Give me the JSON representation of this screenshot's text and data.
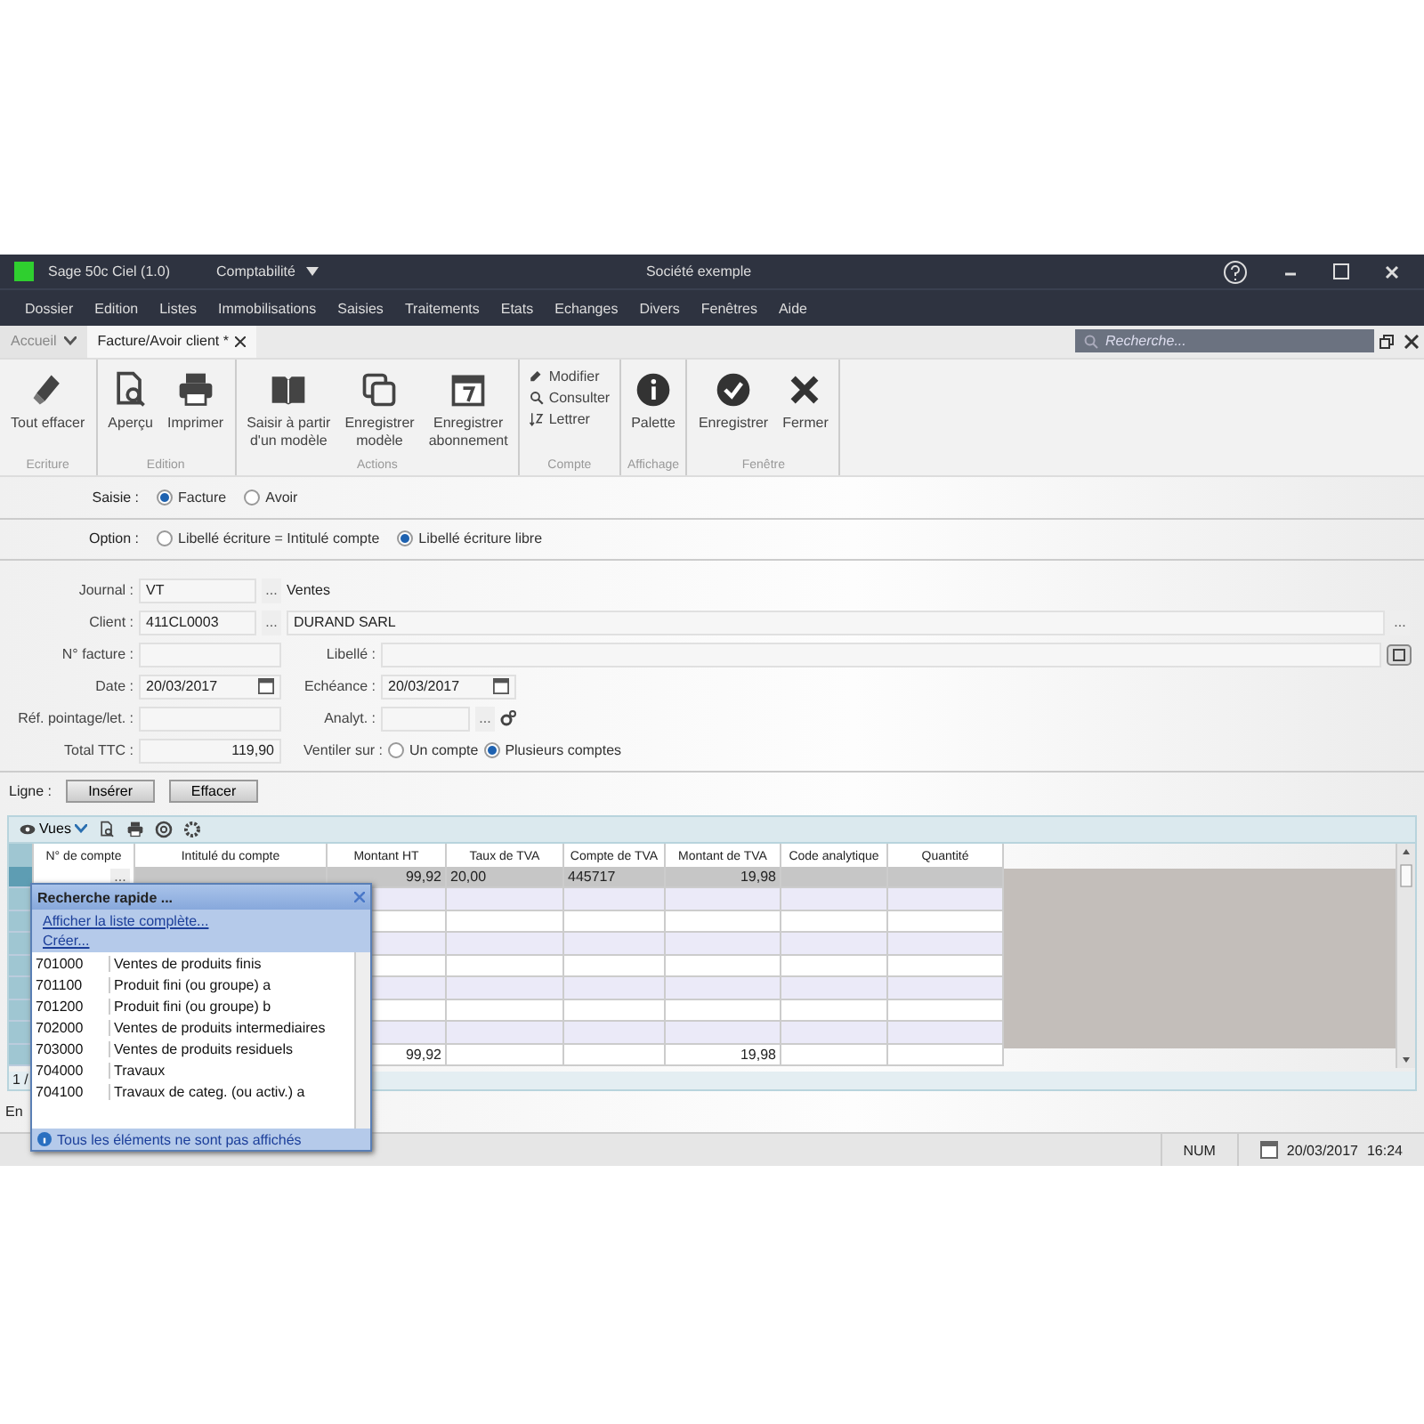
{
  "title_bar": {
    "app": "Sage 50c Ciel (1.0)",
    "module": "Comptabilité",
    "company": "Société exemple"
  },
  "menu": [
    "Dossier",
    "Edition",
    "Listes",
    "Immobilisations",
    "Saisies",
    "Traitements",
    "Etats",
    "Echanges",
    "Divers",
    "Fenêtres",
    "Aide"
  ],
  "tabs": [
    {
      "label": "Accueil",
      "selected": false
    },
    {
      "label": "Facture/Avoir client *",
      "selected": true
    }
  ],
  "search": {
    "placeholder": "Recherche..."
  },
  "ribbon": [
    {
      "label": "Ecriture",
      "kind": "large",
      "buttons": [
        {
          "label": "Tout effacer",
          "kind": "eraser"
        }
      ]
    },
    {
      "label": "Edition",
      "kind": "large",
      "buttons": [
        {
          "label": "Aperçu",
          "kind": "preview"
        },
        {
          "label": "Imprimer",
          "kind": "printer"
        }
      ]
    },
    {
      "label": "Actions",
      "kind": "large",
      "buttons": [
        {
          "label": "Saisir à partir\nd'un modèle",
          "kind": "book"
        },
        {
          "label": "Enregistrer\nmodèle",
          "kind": "copy"
        },
        {
          "label": "Enregistrer\nabonnement",
          "kind": "calendar"
        }
      ]
    },
    {
      "label": "Compte",
      "kind": "stack",
      "buttons": [
        {
          "label": "Modifier",
          "kind": "edit"
        },
        {
          "label": "Consulter",
          "kind": "search"
        },
        {
          "label": "Lettrer",
          "kind": "sort"
        }
      ]
    },
    {
      "label": "Affichage",
      "kind": "large",
      "buttons": [
        {
          "label": "Palette",
          "kind": "info"
        }
      ]
    },
    {
      "label": "Fenêtre",
      "kind": "large",
      "buttons": [
        {
          "label": "Enregistrer",
          "kind": "check"
        },
        {
          "label": "Fermer",
          "kind": "close"
        }
      ]
    }
  ],
  "saisie": {
    "label": "Saisie :",
    "options": [
      {
        "label": "Facture",
        "selected": true
      },
      {
        "label": "Avoir",
        "selected": false
      }
    ]
  },
  "option": {
    "label": "Option :",
    "options": [
      {
        "label": "Libellé écriture = Intitulé compte",
        "selected": false
      },
      {
        "label": "Libellé écriture libre",
        "selected": true
      }
    ]
  },
  "form": {
    "journal": {
      "label": "Journal :",
      "value": "VT",
      "button": "...",
      "name": "Ventes"
    },
    "client": {
      "label": "Client :",
      "value": "411CL0003",
      "button": "...",
      "name": "DURAND SARL",
      "name_button": "..."
    },
    "invoice": {
      "label": "N° facture :"
    },
    "libelle": {
      "label": "Libellé :"
    },
    "date": {
      "label": "Date :",
      "value": "20/03/2017"
    },
    "due": {
      "label": "Echéance :",
      "value": "20/03/2017"
    },
    "ref": {
      "label": "Réf. pointage/let. :"
    },
    "analyt": {
      "label": "Analyt. :",
      "button": "..."
    },
    "total": {
      "label": "Total TTC :",
      "value": "119,90"
    },
    "ventiler": {
      "label": "Ventiler sur :",
      "options": [
        {
          "label": "Un compte",
          "selected": false
        },
        {
          "label": "Plusieurs comptes",
          "selected": true
        }
      ]
    }
  },
  "ligne": {
    "label": "Ligne :",
    "buttons": [
      "Insérer",
      "Effacer"
    ]
  },
  "grid_toolbar": {
    "views": "Vues"
  },
  "table": {
    "columns": [
      "N° de compte",
      "Intitulé du compte",
      "Montant HT",
      "Taux de TVA",
      "Compte de TVA",
      "Montant de TVA",
      "Code analytique",
      "Quantité"
    ],
    "rows": [
      {
        "selected": true,
        "cells": {
          "0": "...",
          "2": "99,92",
          "3": "20,00",
          "4": "445717",
          "5": "19,98"
        }
      },
      {
        "selected": false
      },
      {
        "selected": false
      },
      {
        "selected": false
      },
      {
        "selected": false
      },
      {
        "selected": false
      },
      {
        "selected": false
      },
      {
        "selected": false
      }
    ],
    "totals": {
      "2": "99,92",
      "5": "19,98"
    },
    "pager": "1 /"
  },
  "footer_label": "En",
  "status_bar": {
    "num": "NUM",
    "date": "20/03/2017",
    "time": "16:24"
  },
  "popup": {
    "title": "Recherche rapide ...",
    "links": [
      "Afficher la liste complète...",
      "Créer..."
    ],
    "items": [
      {
        "code": "701000",
        "label": "Ventes de produits finis"
      },
      {
        "code": "701100",
        "label": "Produit fini (ou groupe) a"
      },
      {
        "code": "701200",
        "label": "Produit fini (ou groupe) b"
      },
      {
        "code": "702000",
        "label": "Ventes de produits intermediaires"
      },
      {
        "code": "703000",
        "label": "Ventes de produits residuels"
      },
      {
        "code": "704000",
        "label": "Travaux"
      },
      {
        "code": "704100",
        "label": "Travaux de categ. (ou activ.) a"
      }
    ],
    "footer": "Tous les éléments ne sont pas affichés"
  }
}
